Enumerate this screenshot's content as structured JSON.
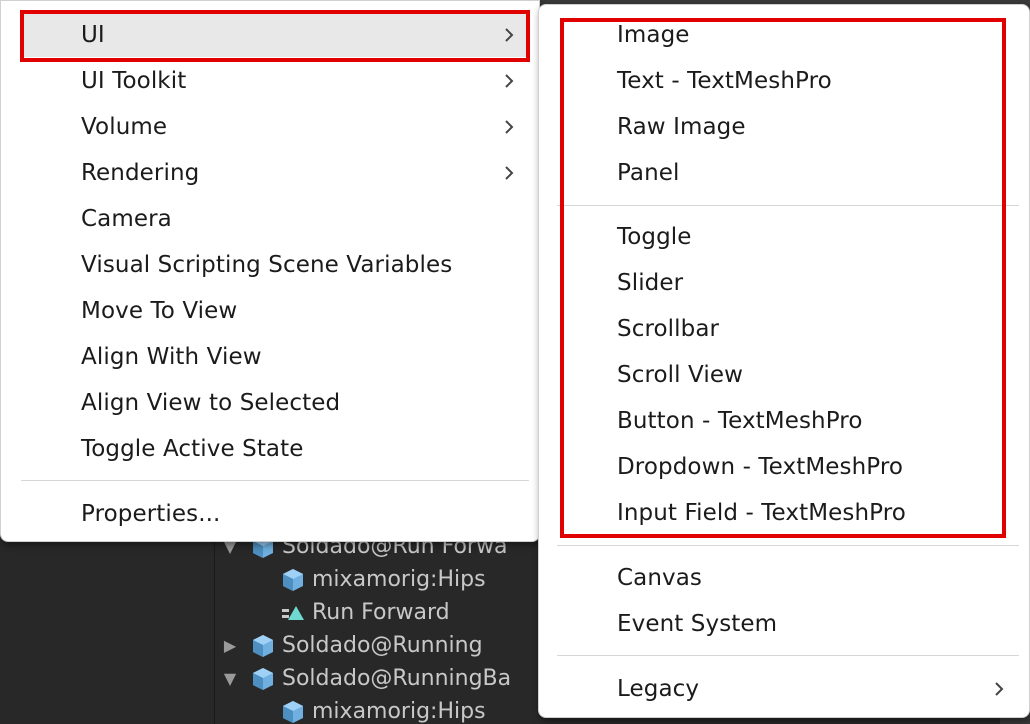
{
  "hierarchy": {
    "rows": [
      {
        "label": "Soldado@Run Forwa",
        "arrow": "▼",
        "icon": "prefab-icon"
      },
      {
        "label": "mixamorig:Hips",
        "arrow": "",
        "icon": "prefab-icon"
      },
      {
        "label": "Run Forward",
        "arrow": "",
        "icon": "animation-clip-icon"
      },
      {
        "label": "Soldado@Running",
        "arrow": "▶",
        "icon": "prefab-icon"
      },
      {
        "label": "Soldado@RunningBa",
        "arrow": "▼",
        "icon": "prefab-icon"
      },
      {
        "label": "mixamorig:Hips",
        "arrow": "",
        "icon": "prefab-icon"
      }
    ]
  },
  "left_menu": {
    "items": [
      {
        "label": "UI",
        "submenu": true,
        "highlighted": true
      },
      {
        "label": "UI Toolkit",
        "submenu": true
      },
      {
        "label": "Volume",
        "submenu": true
      },
      {
        "label": "Rendering",
        "submenu": true
      },
      {
        "label": "Camera",
        "submenu": false
      },
      {
        "label": "Visual Scripting Scene Variables",
        "submenu": false
      },
      {
        "label": "Move To View",
        "submenu": false
      },
      {
        "label": "Align With View",
        "submenu": false
      },
      {
        "label": "Align View to Selected",
        "submenu": false
      },
      {
        "label": "Toggle Active State",
        "submenu": false
      }
    ],
    "footer_items": [
      {
        "label": "Properties...",
        "submenu": false
      }
    ]
  },
  "right_menu": {
    "group1": [
      {
        "label": "Image"
      },
      {
        "label": "Text - TextMeshPro"
      },
      {
        "label": "Raw Image"
      },
      {
        "label": "Panel"
      }
    ],
    "group2": [
      {
        "label": "Toggle"
      },
      {
        "label": "Slider"
      },
      {
        "label": "Scrollbar"
      },
      {
        "label": "Scroll View"
      },
      {
        "label": "Button - TextMeshPro"
      },
      {
        "label": "Dropdown - TextMeshPro"
      },
      {
        "label": "Input Field - TextMeshPro"
      }
    ],
    "group3": [
      {
        "label": "Canvas"
      },
      {
        "label": "Event System"
      }
    ],
    "group4": [
      {
        "label": "Legacy",
        "submenu": true
      }
    ]
  },
  "colors": {
    "highlight_box": "#e00000",
    "menu_background": "#ffffff",
    "item_highlight": "#e8e8e8",
    "editor_background": "#282828"
  }
}
